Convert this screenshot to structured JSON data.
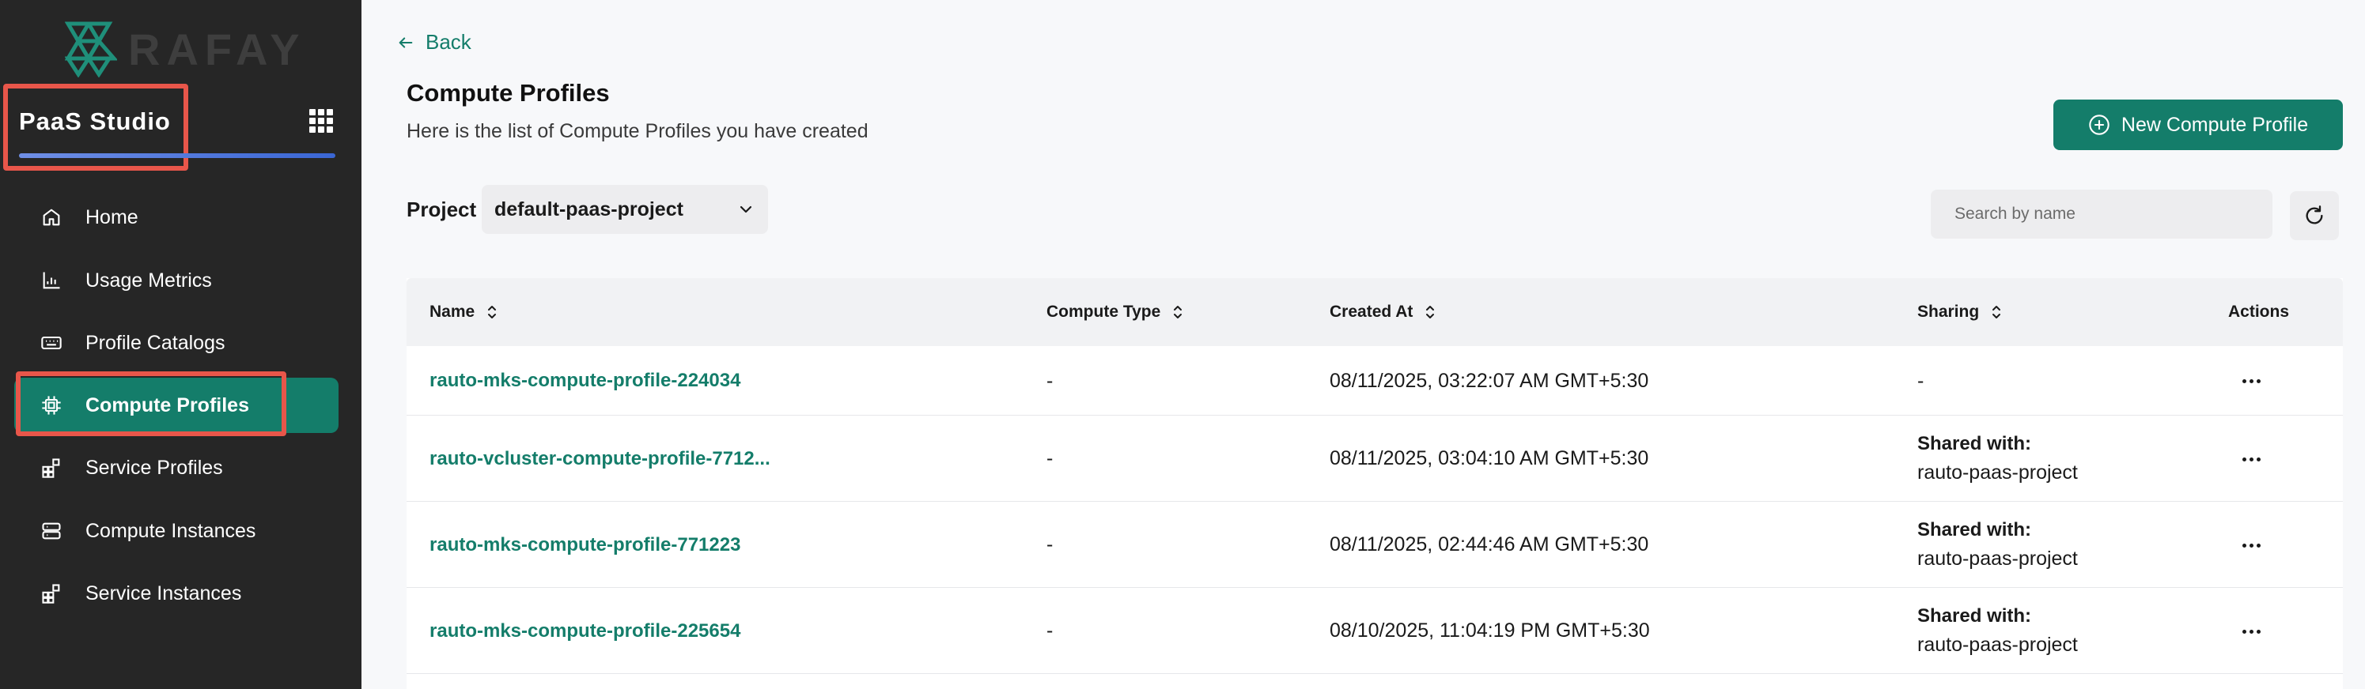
{
  "app": {
    "brand": "RAFAY",
    "studio_name": "PaaS Studio"
  },
  "sidebar": {
    "items": [
      {
        "label": "Home",
        "icon": "home-icon",
        "active": false
      },
      {
        "label": "Usage Metrics",
        "icon": "bar-chart-icon",
        "active": false
      },
      {
        "label": "Profile Catalogs",
        "icon": "keyboard-icon",
        "active": false
      },
      {
        "label": "Compute Profiles",
        "icon": "chip-icon",
        "active": true
      },
      {
        "label": "Service Profiles",
        "icon": "blocks-icon",
        "active": false
      },
      {
        "label": "Compute Instances",
        "icon": "server-icon",
        "active": false
      },
      {
        "label": "Service Instances",
        "icon": "blocks-icon",
        "active": false
      }
    ]
  },
  "header": {
    "back_label": "Back",
    "title": "Compute Profiles",
    "subtitle": "Here is the list of Compute Profiles you have created",
    "new_button_label": "New Compute Profile"
  },
  "filters": {
    "project_label": "Project",
    "project_value": "default-paas-project",
    "search_placeholder": "Search by name"
  },
  "table": {
    "columns": [
      "Name",
      "Compute Type",
      "Created At",
      "Sharing",
      "Actions"
    ],
    "rows": [
      {
        "name": "rauto-mks-compute-profile-224034",
        "compute_type": "-",
        "created_at": "08/11/2025, 03:22:07 AM GMT+5:30",
        "sharing_head": "",
        "sharing_value": "-"
      },
      {
        "name": "rauto-vcluster-compute-profile-7712...",
        "compute_type": "-",
        "created_at": "08/11/2025, 03:04:10 AM GMT+5:30",
        "sharing_head": "Shared with:",
        "sharing_value": "rauto-paas-project"
      },
      {
        "name": "rauto-mks-compute-profile-771223",
        "compute_type": "-",
        "created_at": "08/11/2025, 02:44:46 AM GMT+5:30",
        "sharing_head": "Shared with:",
        "sharing_value": "rauto-paas-project"
      },
      {
        "name": "rauto-mks-compute-profile-225654",
        "compute_type": "-",
        "created_at": "08/10/2025, 11:04:19 PM GMT+5:30",
        "sharing_head": "Shared with:",
        "sharing_value": "rauto-paas-project"
      }
    ]
  },
  "colors": {
    "sidebar_bg": "#262626",
    "accent": "#147d6a",
    "highlight_border": "#e8564a",
    "studio_underline": "#3a66d4"
  }
}
